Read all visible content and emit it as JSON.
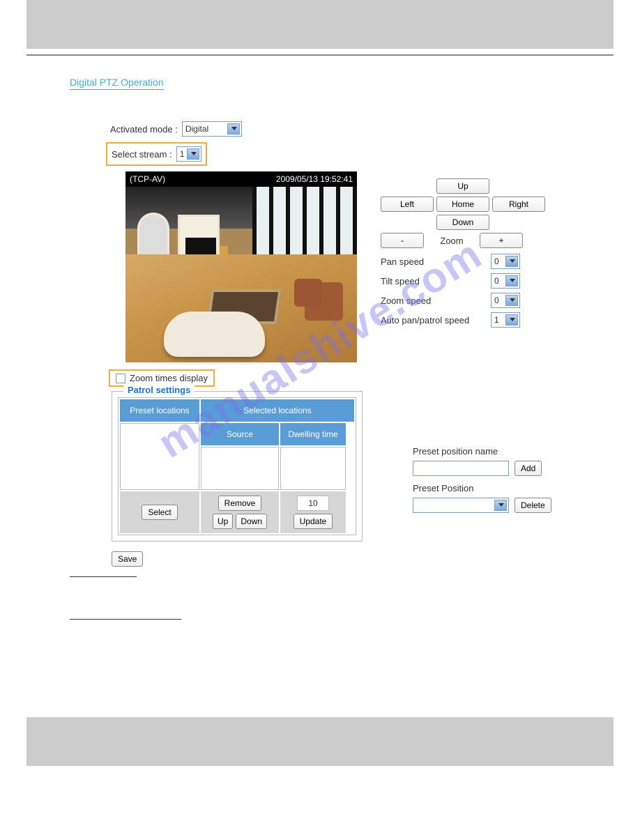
{
  "section_title": "Digital PTZ Operation",
  "activated_mode": {
    "label": "Activated mode :",
    "value": "Digital"
  },
  "select_stream": {
    "label": "Select stream :",
    "value": "1"
  },
  "video_overlay": {
    "left": "(TCP-AV)",
    "right": "2009/05/13 19:52:41"
  },
  "nav": {
    "up": "Up",
    "left": "Left",
    "home": "Home",
    "right": "Right",
    "down": "Down"
  },
  "zoom": {
    "minus": "-",
    "label": "Zoom",
    "plus": "+"
  },
  "speeds": {
    "pan": {
      "label": "Pan speed",
      "value": "0"
    },
    "tilt": {
      "label": "Tilt speed",
      "value": "0"
    },
    "zoom": {
      "label": "Zoom speed",
      "value": "0"
    },
    "auto": {
      "label": "Auto pan/patrol speed",
      "value": "1"
    }
  },
  "zoom_times_display": "Zoom times display",
  "patrol": {
    "legend": "Patrol settings",
    "preset_header": "Preset locations",
    "selected_header": "Selected locations",
    "source_header": "Source",
    "dwell_header": "Dwelling time",
    "select_btn": "Select",
    "remove_btn": "Remove",
    "up_btn": "Up",
    "down_btn": "Down",
    "dwell_value": "10",
    "update_btn": "Update"
  },
  "preset": {
    "name_label": "Preset position name",
    "add_btn": "Add",
    "pos_label": "Preset Position",
    "delete_btn": "Delete"
  },
  "save_btn": "Save",
  "watermark": "manualshive.com"
}
